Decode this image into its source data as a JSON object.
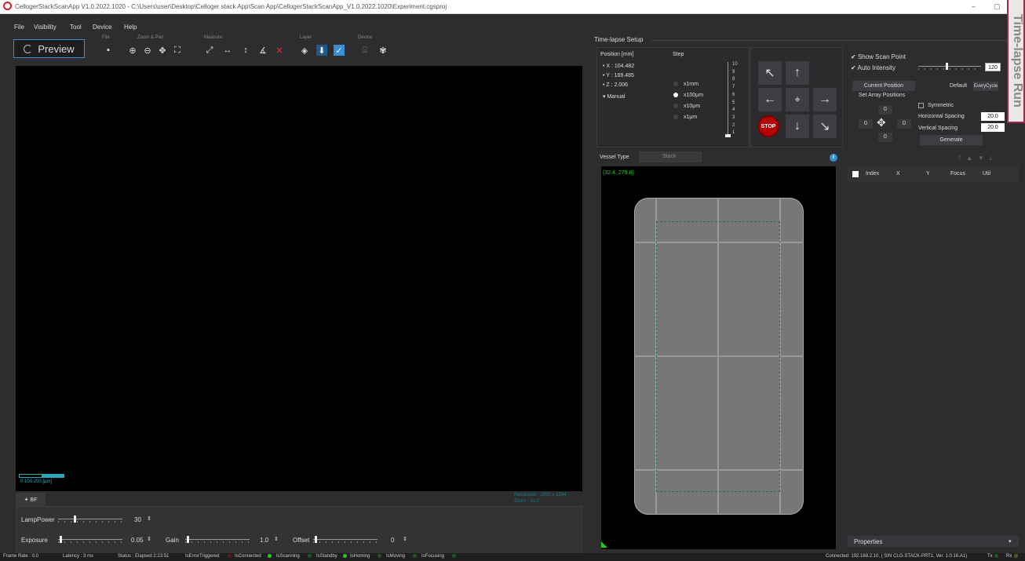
{
  "app": {
    "title": "CellogerStackScanApp V1.0.2022.1020 - C:\\Users\\user\\Desktop\\Celloger stack App\\Scan App\\CellogerStackScanApp_V1.0.2022.1020\\Experiment.cgsproj",
    "minimize": "–",
    "restore": "▢"
  },
  "menu": [
    "File",
    "Visibility",
    "Tool",
    "Device",
    "Help"
  ],
  "toolbar": {
    "groups": {
      "file": "File",
      "zoom": "Zoom & Pan",
      "measure": "Measure",
      "layer": "Layer",
      "device": "Device"
    },
    "preview_label": "Preview"
  },
  "viewer": {
    "scalebar_label": "0     100   200 [μm]",
    "resolution": "Resolution : 2592 x 1944",
    "zoom": "Zoom : x1.0"
  },
  "bf": {
    "tab": "✦ BF",
    "lamp_label": "LampPower",
    "lamp_value": "30",
    "lamp_level": 0.25,
    "exposure_label": "Exposure",
    "exposure_value": "0.05",
    "exposure_level": 0.03,
    "gain_label": "Gain",
    "gain_value": "1.0",
    "gain_level": 0.03,
    "offset_label": "Offset",
    "offset_value": "0",
    "offset_level": 0.03
  },
  "timelapse": {
    "header": "Time-lapse Setup",
    "position_title": "Position [mm]",
    "x": "• X :  104.482",
    "y": "• Y :  169.485",
    "z": "• Z :   2.006",
    "manual": "▾  Manual",
    "step_title": "Step",
    "steps": [
      "x1mm",
      "x100μm",
      "x10μm",
      "x1μm"
    ],
    "selected_step": "x100μm",
    "scale_ticks": [
      "10",
      "9",
      "8",
      "7",
      "6",
      "5",
      "4",
      "3",
      "2",
      "1"
    ],
    "stop_label": "STOP",
    "show_scan_point": "Show Scan Point",
    "auto_intensity": "Auto Intensity",
    "intensity_value": "120",
    "intensity_level": 0.45,
    "current_position": "Current Position",
    "default": "Default",
    "every_cycle": "EveryCycle",
    "set_array": "Set Array Positions",
    "arr_top": "0",
    "arr_left": "0",
    "arr_right": "0",
    "arr_bottom": "0",
    "symmetric": "Symmetric",
    "h_spacing_label": "Horizontal Spacing",
    "h_spacing": "20.0",
    "v_spacing_label": "Vertical Spacing",
    "v_spacing": "20.0",
    "generate": "Generate"
  },
  "vessel": {
    "type_label": "Vessel Type",
    "type_value": "Stack",
    "coords": "(32.4, 279.8)"
  },
  "table": {
    "columns": [
      "Index",
      "X",
      "Y",
      "Focus",
      "Util"
    ]
  },
  "properties": "Properties",
  "side_tab": "Time-lapse Run",
  "status": {
    "frame_rate": "Frame Rate : 0.0",
    "latency": "Latency : 3 ms",
    "status": "Status :  Elapsed 2:23:51",
    "flags": [
      {
        "name": "IsErrorTriggered",
        "color": "#5a1a1a"
      },
      {
        "name": "IsConnected",
        "color": "#22cc22"
      },
      {
        "name": "IsScanning",
        "color": "#1e5a1e"
      },
      {
        "name": "IsStandby",
        "color": "#22cc22"
      },
      {
        "name": "IsHoming",
        "color": "#1e5a1e"
      },
      {
        "name": "IsMoving",
        "color": "#1e5a1e"
      },
      {
        "name": "IsFocusing",
        "color": "#1e5a1e"
      }
    ],
    "connection": "Connected: 192.168.2.10, ( S/N CLG-STACK-PRT1, Ver. 1.0.16.A1)",
    "tx": "Tx",
    "rx": "Rx"
  }
}
